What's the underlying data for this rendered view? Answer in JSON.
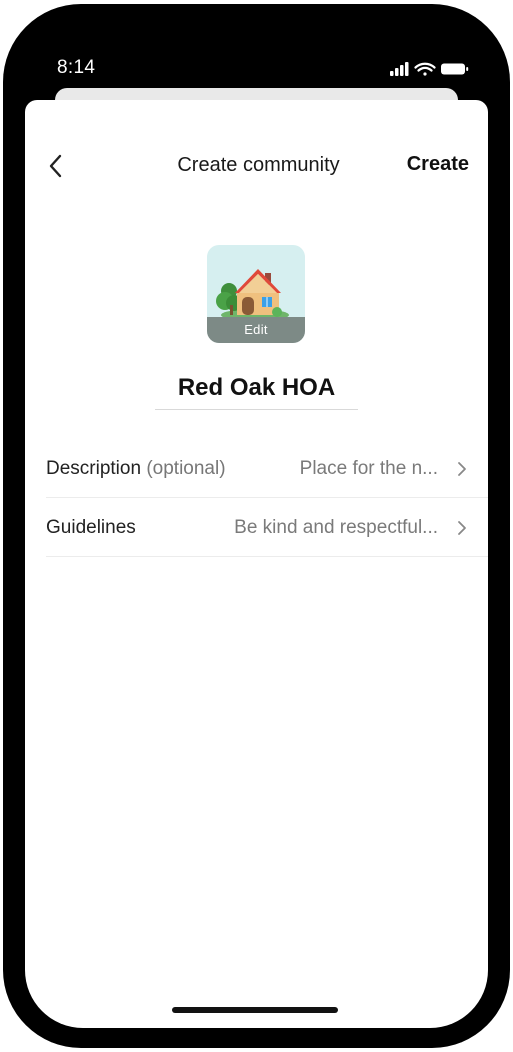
{
  "status_bar": {
    "time": "8:14",
    "icons": [
      "cellular-signal-icon",
      "wifi-icon",
      "battery-icon"
    ]
  },
  "nav": {
    "title": "Create community",
    "action_label": "Create",
    "back_icon": "chevron-left-icon"
  },
  "avatar": {
    "icon": "house-icon",
    "edit_label": "Edit",
    "background": "#d6eff0"
  },
  "community": {
    "name": "Red Oak HOA"
  },
  "settings_rows": [
    {
      "label": "Description",
      "label_suffix": "(optional)",
      "value": "Place for the n...",
      "icon": "chevron-right-icon"
    },
    {
      "label": "Guidelines",
      "label_suffix": "",
      "value": "Be kind and respectful...",
      "icon": "chevron-right-icon"
    }
  ],
  "colors": {
    "frame": "#000000",
    "sheet": "#ffffff",
    "text_primary": "#111111",
    "text_secondary": "#7a7a7a",
    "divider": "#ececec"
  }
}
